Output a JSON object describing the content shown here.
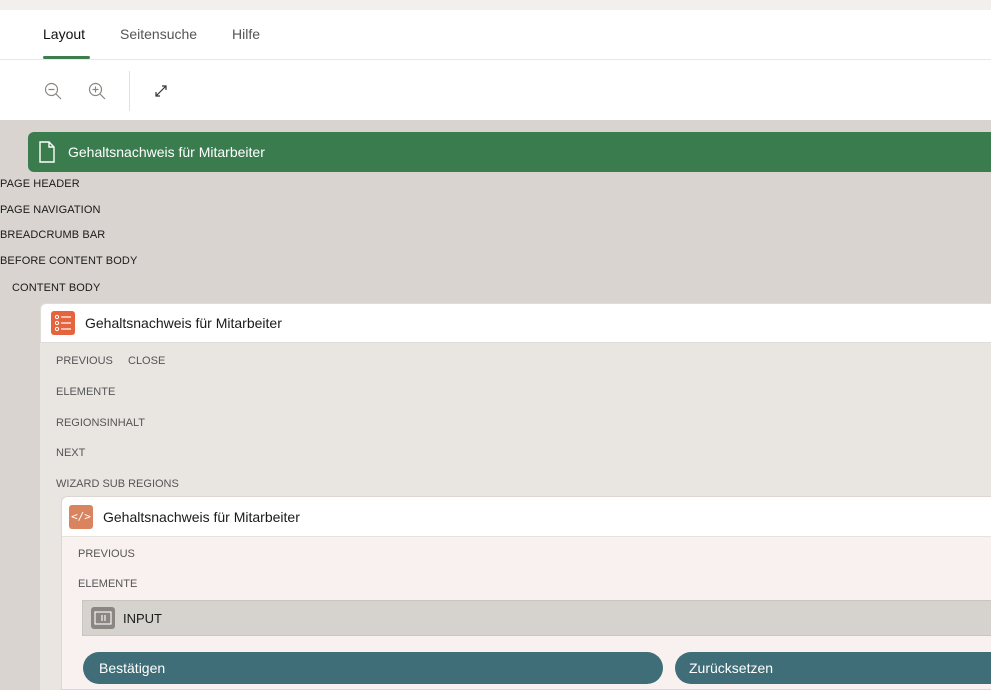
{
  "tabs": [
    {
      "label": "Layout"
    },
    {
      "label": "Seitensuche"
    },
    {
      "label": "Hilfe"
    }
  ],
  "toolbar": {
    "zoom_out_icon": "zoom-out-icon",
    "zoom_in_icon": "zoom-in-icon",
    "expand_icon": "expand-icon"
  },
  "page": {
    "title": "Gehaltsnachweis für Mitarbeiter",
    "positions": [
      "PAGE HEADER",
      "PAGE NAVIGATION",
      "BREADCRUMB BAR",
      "BEFORE CONTENT BODY",
      "CONTENT BODY"
    ]
  },
  "wizard_region": {
    "title": "Gehaltsnachweis für Mitarbeiter",
    "slots": {
      "previous": "PREVIOUS",
      "close": "CLOSE",
      "elements": "ELEMENTE",
      "region_content": "REGIONSINHALT",
      "next": "NEXT",
      "sub_regions": "WIZARD SUB REGIONS"
    }
  },
  "sub_region": {
    "title": "Gehaltsnachweis für Mitarbeiter",
    "slots": {
      "previous": "PREVIOUS",
      "elements": "ELEMENTE"
    },
    "input_label": "INPUT",
    "buttons": {
      "confirm": "Bestätigen",
      "reset": "Zurücksetzen"
    }
  },
  "colors": {
    "page_header": "#3b7c4f",
    "tab_underline": "#3f7d4f",
    "list_icon": "#e5633d",
    "code_icon": "#d9845e",
    "button": "#3f6e78",
    "canvas": "#d9d4cf"
  }
}
